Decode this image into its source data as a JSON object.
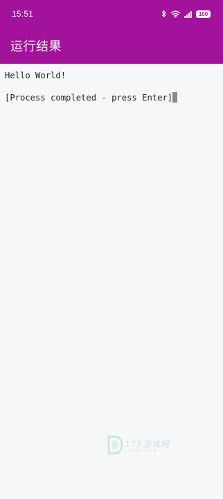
{
  "status_bar": {
    "time": "15:51",
    "icons": [
      "bluetooth-icon",
      "wifi-icon",
      "signal-icon"
    ],
    "battery": "100"
  },
  "app_bar": {
    "title": "运行结果"
  },
  "terminal": {
    "lines": [
      "Hello World!",
      "",
      "[Process completed - press Enter]"
    ],
    "cursor_visible": true
  },
  "watermark": {
    "text": "175游戏网",
    "sub": "175SC.COM"
  },
  "colors": {
    "accent": "#a3129b",
    "background": "#f6f7f8",
    "text": "#222222",
    "cursor": "#8a8a8a"
  }
}
